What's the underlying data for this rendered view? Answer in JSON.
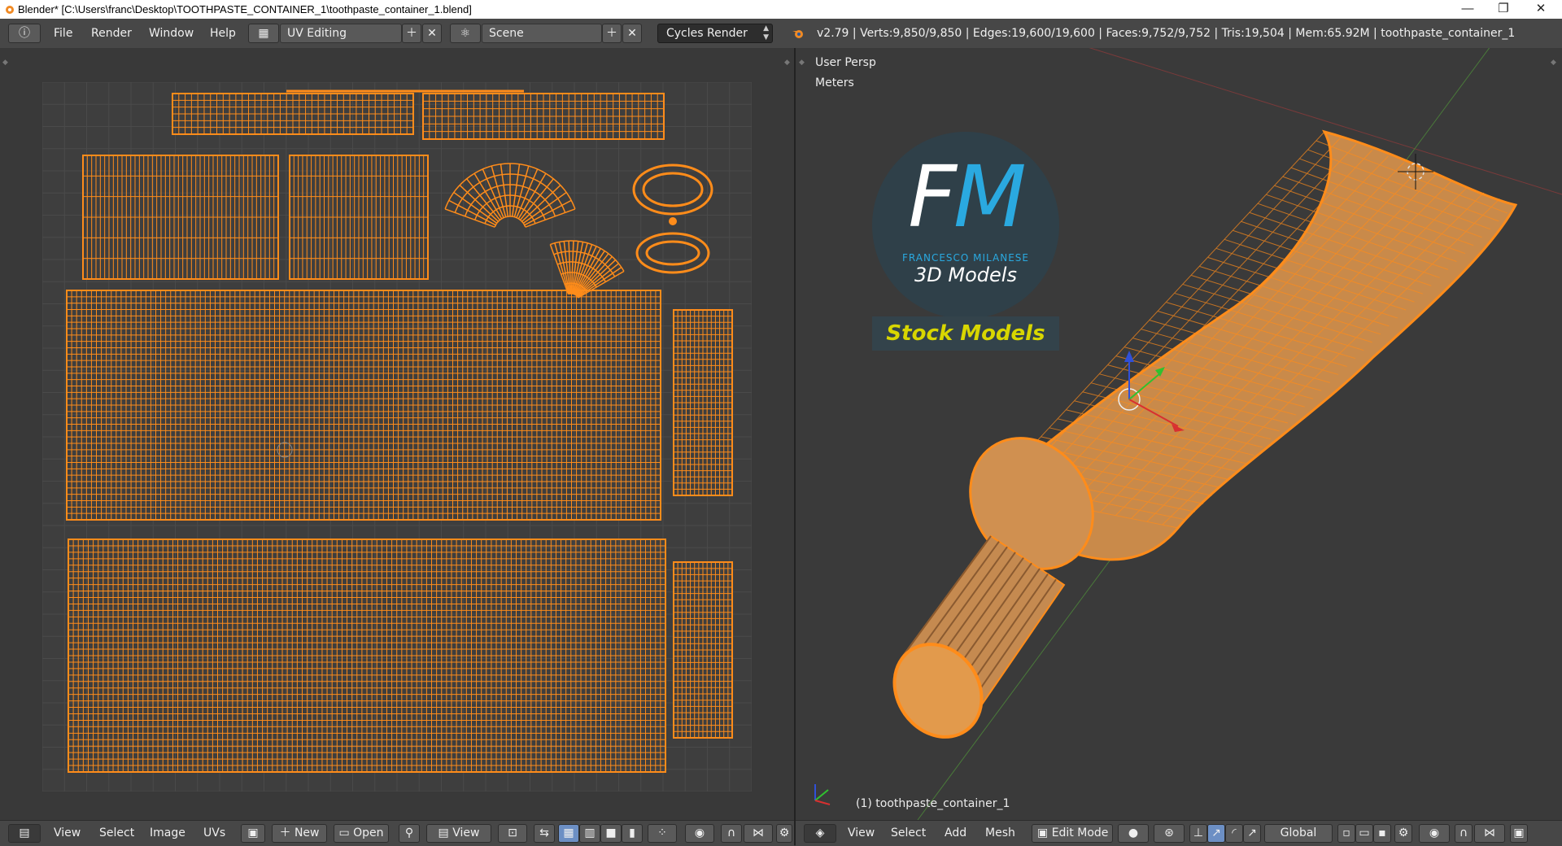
{
  "window": {
    "title": "Blender* [C:\\Users\\franc\\Desktop\\TOOTHPASTE_CONTAINER_1\\toothpaste_container_1.blend]",
    "minimize": "—",
    "restore": "❐",
    "close": "✕"
  },
  "info_header": {
    "menus": [
      "File",
      "Render",
      "Window",
      "Help"
    ],
    "screen_layout": "UV Editing",
    "scene": "Scene",
    "render_engine": "Cycles Render",
    "stats": "v2.79 | Verts:9,850/9,850 | Edges:19,600/19,600 | Faces:9,752/9,752 | Tris:19,504 | Mem:65.92M | toothpaste_container_1"
  },
  "uv_editor": {
    "footer_menus": [
      "View",
      "Select",
      "Image",
      "UVs"
    ],
    "new_label": "New",
    "open_label": "Open",
    "view_label": "View"
  },
  "viewport": {
    "view_name": "User Persp",
    "units": "Meters",
    "object_label": "(1) toothpaste_container_1",
    "footer_menus": [
      "View",
      "Select",
      "Add",
      "Mesh"
    ],
    "mode": "Edit Mode",
    "orientation": "Global"
  },
  "watermark": {
    "initials_f": "F",
    "initials_m": "M",
    "name": "FRANCESCO MILANESE",
    "sub": "3D Models",
    "banner": "Stock Models"
  },
  "colors": {
    "wire": "#ff8c1a",
    "grid_bg": "#3e3e3e",
    "logo_blue": "#2aa9e0",
    "banner_yellow": "#d8d600"
  }
}
